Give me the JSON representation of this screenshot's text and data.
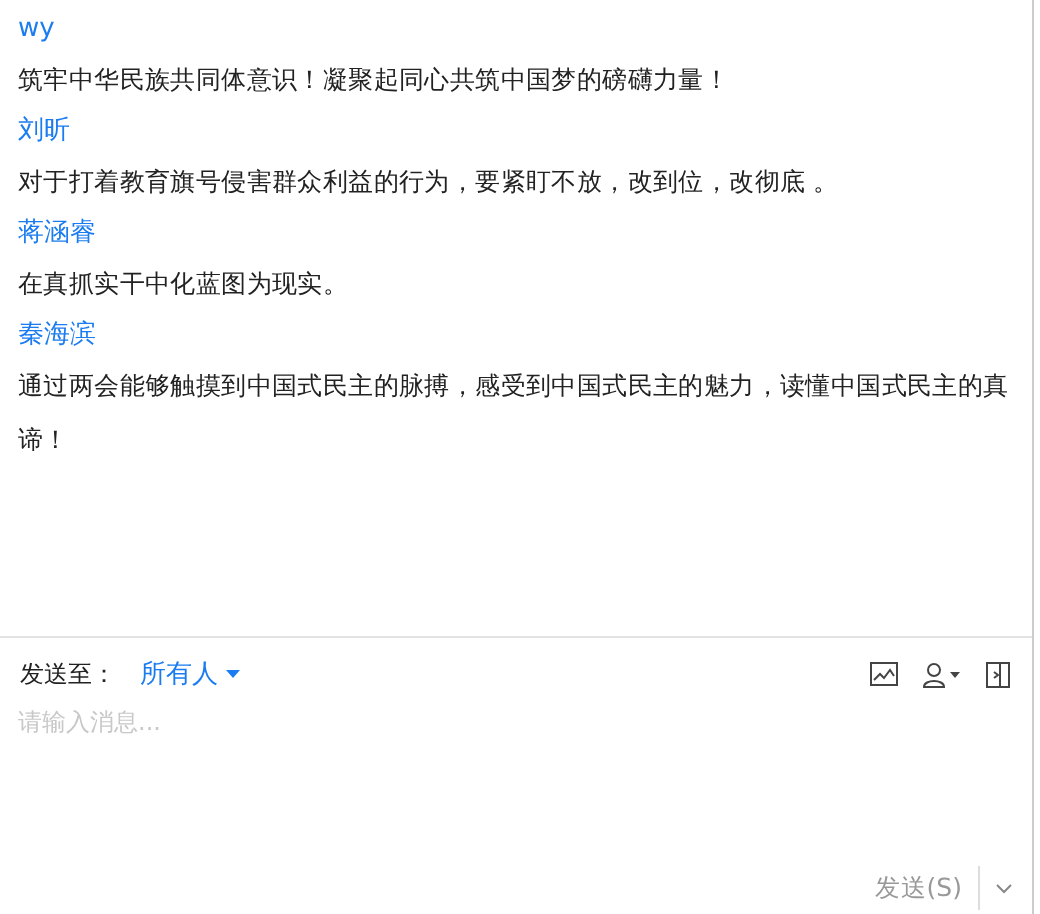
{
  "messages": [
    {
      "sender": "wy",
      "text": "筑牢中华民族共同体意识！凝聚起同心共筑中国梦的磅礴力量！"
    },
    {
      "sender": "刘昕",
      "text": "对于打着教育旗号侵害群众利益的行为，要紧盯不放，改到位，改彻底 。"
    },
    {
      "sender": "蒋涵睿",
      "text": "在真抓实干中化蓝图为现实。"
    },
    {
      "sender": "秦海滨",
      "text": "通过两会能够触摸到中国式民主的脉搏，感受到中国式民主的魅力，读懂中国式民主的真谛！"
    }
  ],
  "composer": {
    "send_to_label": "发送至：",
    "recipient": "所有人",
    "placeholder": "请输入消息...",
    "send_button": "发送(S)"
  }
}
